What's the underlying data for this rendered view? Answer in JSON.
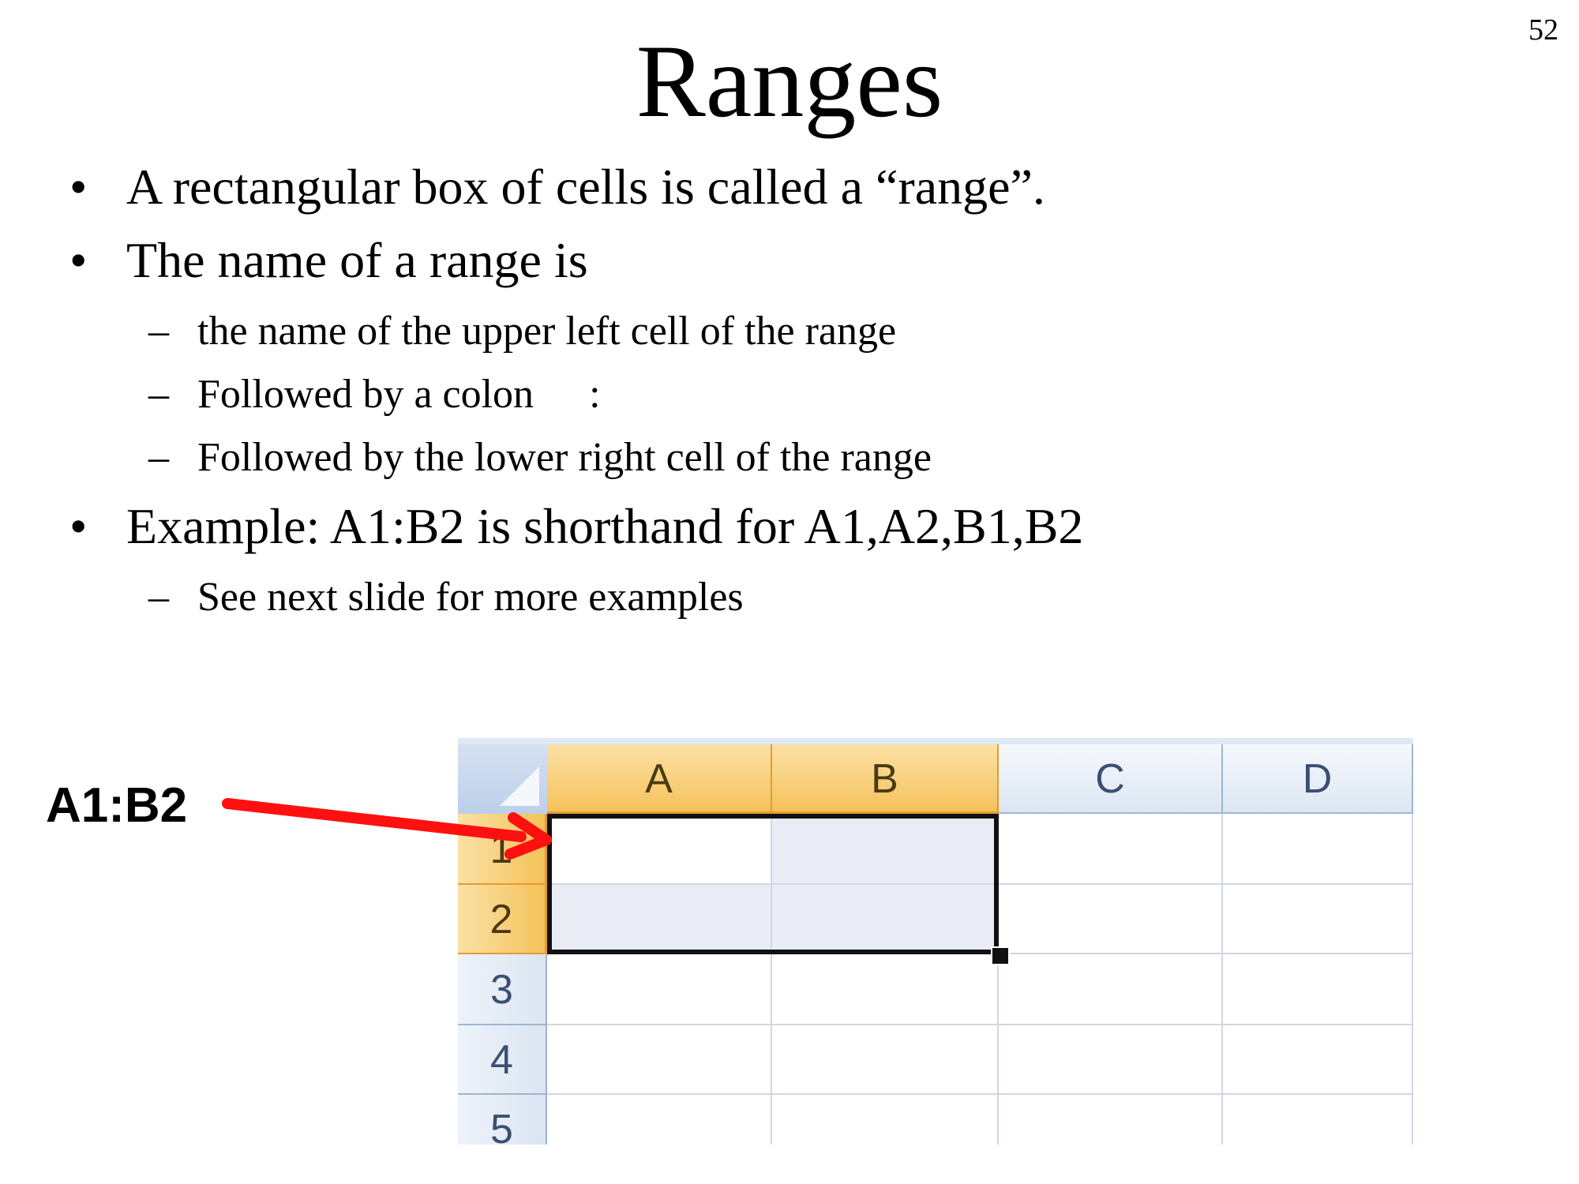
{
  "slide": {
    "page_number": "52",
    "title": "Ranges",
    "bullets": [
      {
        "marker": "•",
        "text": "A rectangular box of cells is called a “range”."
      },
      {
        "marker": "•",
        "text": "The name of a range is"
      },
      {
        "marker": "–",
        "text": "the name of the upper left cell of the range"
      },
      {
        "marker": "–",
        "text": "Followed by a colon",
        "suffix": ":"
      },
      {
        "marker": "–",
        "text": "Followed by the lower right cell of the range"
      },
      {
        "marker": "•",
        "text": "Example: A1:B2 is shorthand for A1,A2,B1,B2"
      },
      {
        "marker": "–",
        "text": "See next slide for more examples"
      }
    ]
  },
  "callout": {
    "label": "A1:B2",
    "arrow_color": "#ff1010"
  },
  "spreadsheet": {
    "columns": [
      "A",
      "B",
      "C",
      "D"
    ],
    "rows": [
      "1",
      "2",
      "3",
      "4",
      "5"
    ],
    "selected_range": "A1:B2",
    "colors": {
      "header_selected": "#f5c25a",
      "header_normal": "#dce6f3",
      "range_fill": "#e9ecf5",
      "grid": "#d0d7e5",
      "selection_border": "#111111"
    }
  }
}
